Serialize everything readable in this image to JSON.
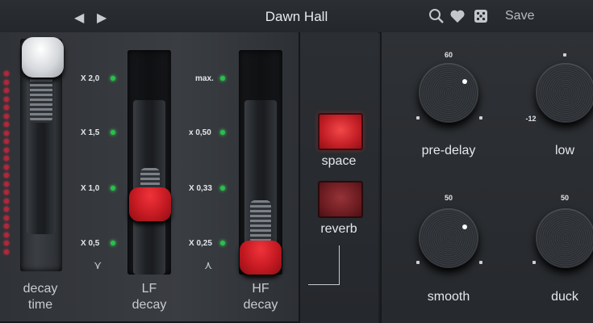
{
  "header": {
    "title": "Dawn Hall",
    "prev_glyph": "◀",
    "next_glyph": "▶",
    "save_label": "Save",
    "icons": [
      "search-icon",
      "heart-icon",
      "dice-icon"
    ]
  },
  "faders": {
    "decay_time": {
      "label_line1": "decay",
      "label_line2": "time"
    },
    "lf_decay": {
      "label_line1": "LF",
      "label_line2": "decay",
      "scale": [
        "X 2,0",
        "X 1,5",
        "X 1,0",
        "X 0,5"
      ],
      "symbol": "⋎"
    },
    "hf_decay": {
      "label_line1": "HF",
      "label_line2": "decay",
      "scale": [
        "max.",
        "x 0,50",
        "X 0,33",
        "X 0,25"
      ],
      "symbol": "⋏"
    }
  },
  "buttons": {
    "space_label": "space",
    "reverb_label": "reverb"
  },
  "knobs": {
    "pre_delay": {
      "label": "pre-delay",
      "value": "60"
    },
    "low": {
      "label": "low",
      "value": "-12"
    },
    "smooth": {
      "label": "smooth",
      "value": "50"
    },
    "duck": {
      "label": "duck",
      "value": "50"
    }
  },
  "colors": {
    "accent_red": "#c51a22",
    "led_green": "#26c24a",
    "led_red": "#b3263a"
  }
}
